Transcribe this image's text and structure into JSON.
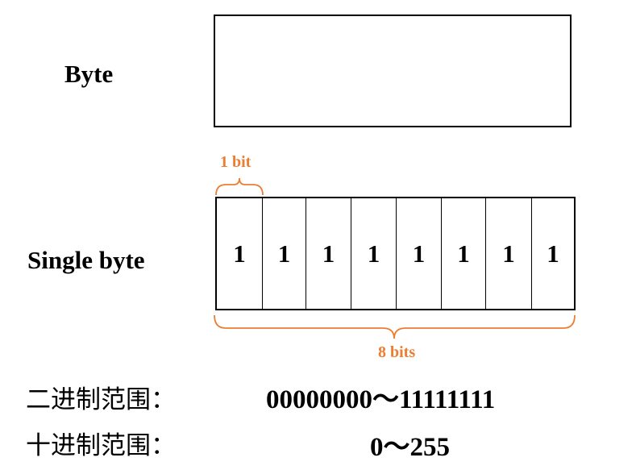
{
  "byte_label": "Byte",
  "single_byte_label": "Single byte",
  "bits": [
    "1",
    "1",
    "1",
    "1",
    "1",
    "1",
    "1",
    "1"
  ],
  "one_bit_label": "1 bit",
  "eight_bits_label": "8 bits",
  "binary_range": {
    "label": "二进制范围：",
    "value": "00000000～11111111"
  },
  "decimal_range": {
    "label": "十进制范围：",
    "value": "0～255"
  },
  "colors": {
    "accent": "#ed7d31",
    "line": "#000000"
  }
}
